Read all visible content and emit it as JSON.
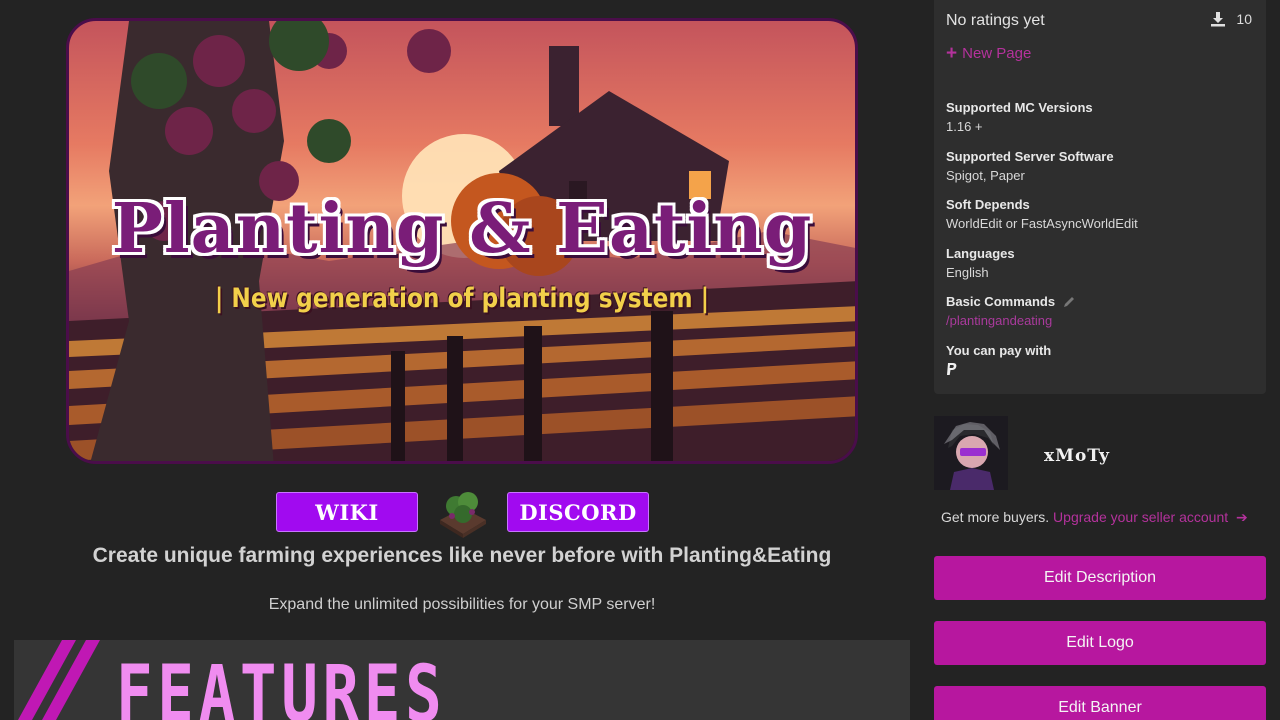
{
  "banner": {
    "title": "Planting & Eating",
    "subtitle": "| New generation of planting system |"
  },
  "buttons": {
    "wiki": "WIKI",
    "discord": "DISCORD"
  },
  "headline": "Create unique farming experiences like never before with Planting&Eating",
  "subline": "Expand the unlimited possibilities for your SMP server!",
  "features": {
    "heading": "FEATURES"
  },
  "sidebar": {
    "rating": "No ratings yet",
    "downloads": "10",
    "new_page": "New Page",
    "info": [
      {
        "label": "Supported MC Versions",
        "value": "1.16 +"
      },
      {
        "label": "Supported Server Software",
        "value": "Spigot, Paper"
      },
      {
        "label": "Soft Depends",
        "value": "WorldEdit or FastAsyncWorldEdit"
      },
      {
        "label": "Languages",
        "value": "English"
      },
      {
        "label": "Basic Commands",
        "value": "/plantingandeating"
      },
      {
        "label": "You can pay with",
        "value": ""
      }
    ],
    "seller_name": "xMoTy",
    "upgrade_prefix": "Get more buyers.",
    "upgrade_link": "Upgrade your seller account",
    "edit_description": "Edit Description",
    "edit_logo": "Edit Logo",
    "edit_banner": "Edit Banner"
  },
  "colors": {
    "accent": "#b7179f",
    "button_purple": "#a10af0",
    "link": "#b4329c",
    "background": "#232323",
    "card": "#2e2e2e"
  }
}
